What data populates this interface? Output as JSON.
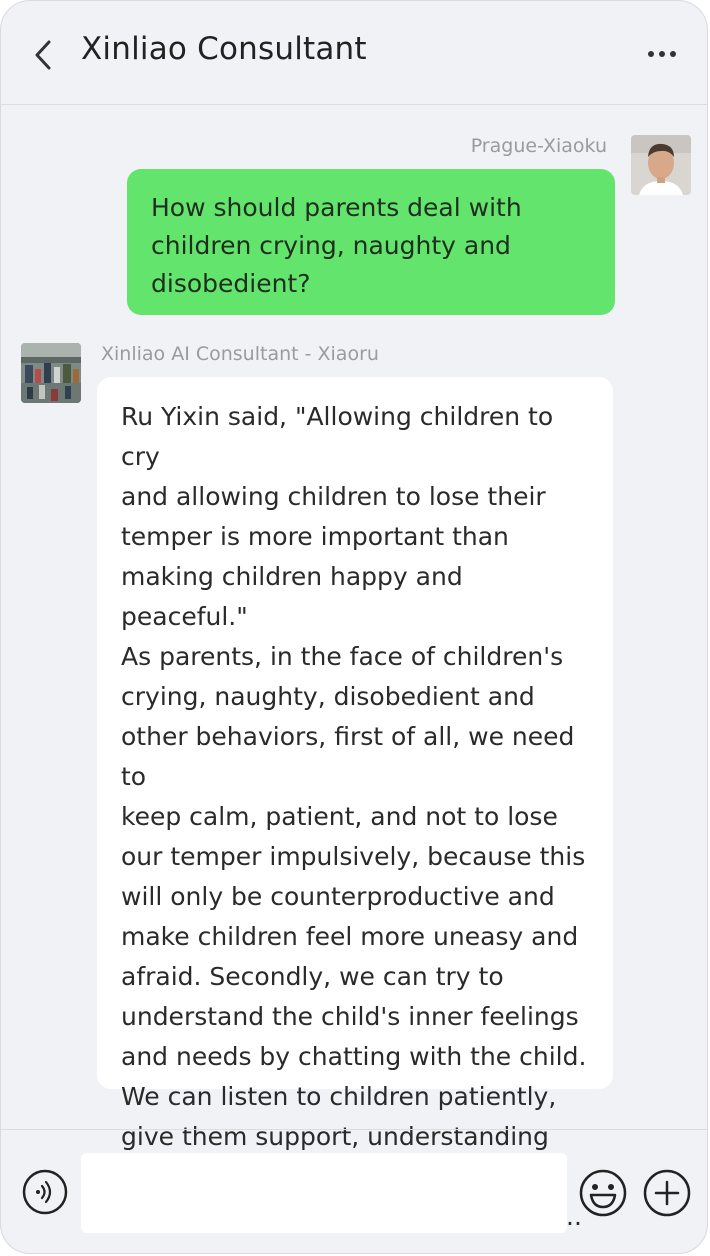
{
  "header": {
    "title": "Xinliao Consultant",
    "back_icon": "chevron-left-icon",
    "more_icon": "more-dots-icon"
  },
  "messages": [
    {
      "sender": "Prague-Xiaoku",
      "side": "right",
      "avatar": "user-photo-avatar",
      "text": "How should parents deal with children crying, naughty and disobedient?"
    },
    {
      "sender": "Xinliao AI Consultant - Xiaoru",
      "side": "left",
      "avatar": "ai-consultant-avatar",
      "text": "Ru Yixin said, \"Allowing children to cry\nand allowing children to lose their\ntemper is more important than\nmaking children happy and peaceful.\"\nAs parents, in the face of children's\ncrying, naughty, disobedient and\nother behaviors, first of all, we need to\n keep calm, patient, and not to lose\nour temper impulsively, because this\nwill only be counterproductive and\nmake children feel more uneasy and\nafraid. Secondly, we can try to\nunderstand the child's inner feelings\nand needs by chatting with the child.\nWe can listen to children patiently,\ngive them support, understanding and\n encouragement, and let them feel ..."
    }
  ],
  "composer": {
    "value": "",
    "placeholder": "",
    "voice_icon": "voice-icon",
    "emoji_icon": "emoji-icon",
    "plus_icon": "plus-icon"
  },
  "colors": {
    "user_bubble": "#63e46d",
    "ai_bubble": "#ffffff",
    "background": "#f1f2f5"
  }
}
